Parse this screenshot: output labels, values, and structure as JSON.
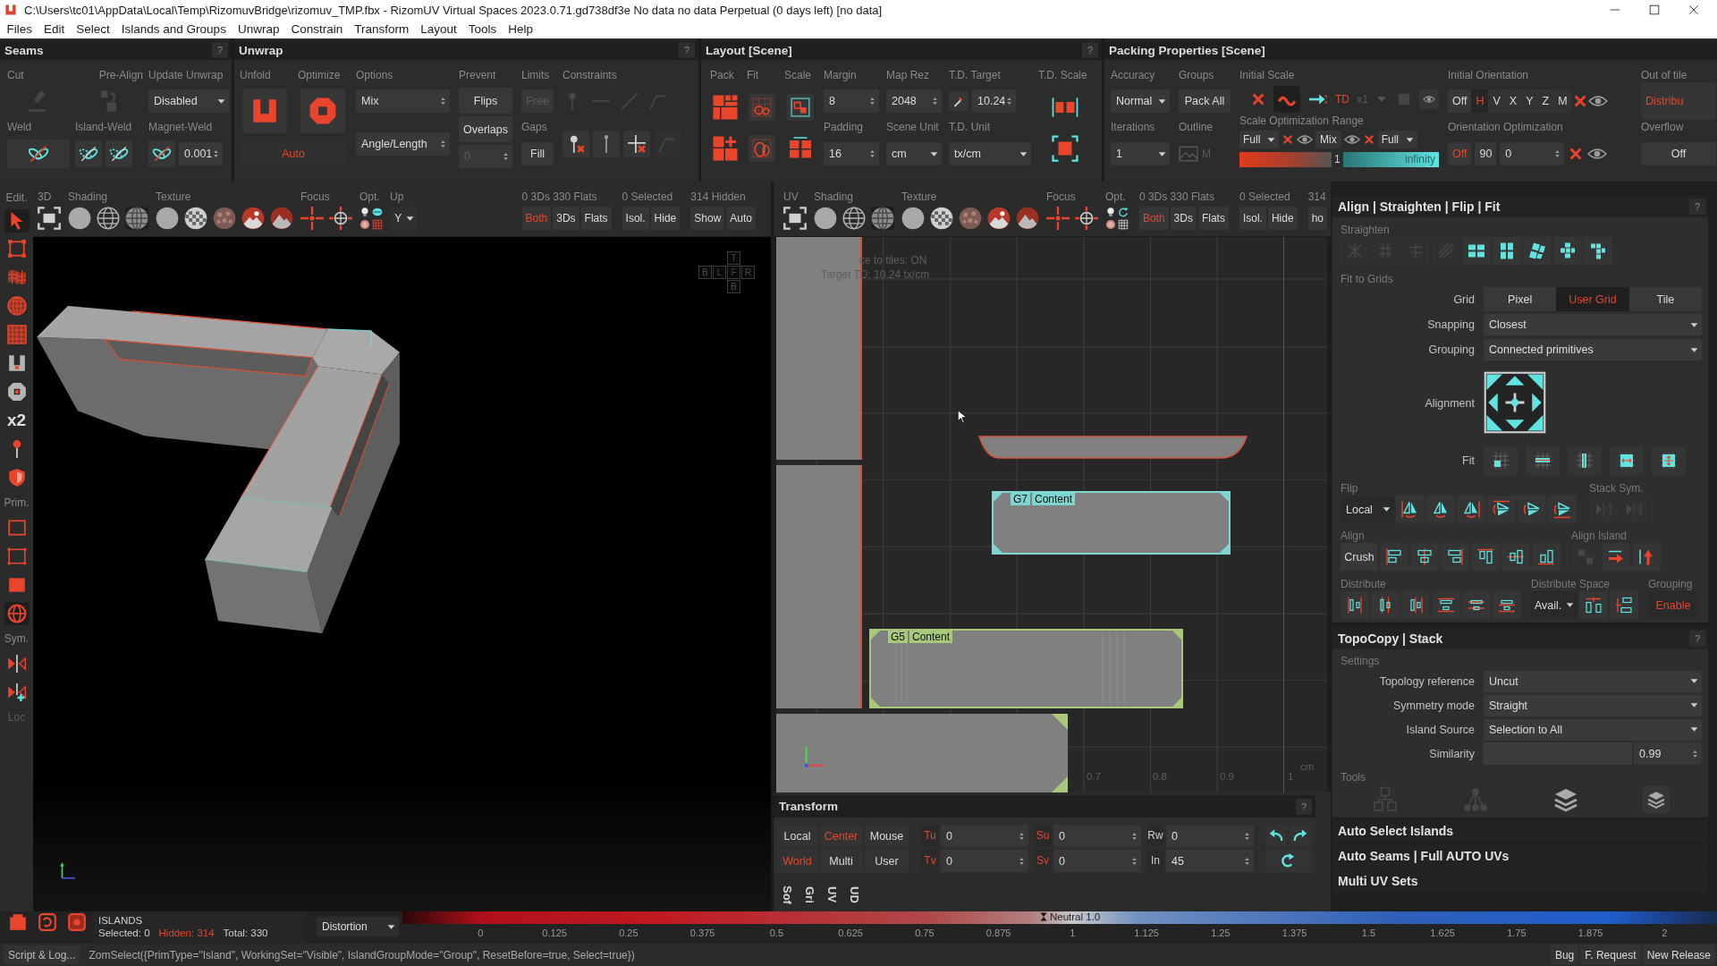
{
  "window": {
    "title": "C:\\Users\\tc01\\AppData\\Local\\Temp\\RizomuvBridge\\rizomuv_TMP.fbx - RizomUV  Virtual Spaces 2023.0.71.gd738df3e No data no data Perpetual  (0 days left) [no data]"
  },
  "menu": [
    "Files",
    "Edit",
    "Select",
    "Islands and Groups",
    "Unwrap",
    "Constrain",
    "Transform",
    "Layout",
    "Tools",
    "Help"
  ],
  "seams": {
    "title": "Seams",
    "help": "?",
    "cut": {
      "label": "Cut",
      "disabled": true
    },
    "pre_align": {
      "label": "Pre-Align",
      "disabled": true
    },
    "update_unwrap": {
      "label": "Update Unwrap",
      "value": "Disabled"
    },
    "weld": {
      "label": "Weld"
    },
    "island_weld": {
      "label": "Island-Weld"
    },
    "magnet_weld": {
      "label": "Magnet-Weld",
      "value": "0.001"
    }
  },
  "unwrap": {
    "title": "Unwrap",
    "help": "?",
    "unfold": "Unfold",
    "optimize": "Optimize",
    "auto": "Auto",
    "options": {
      "label": "Options",
      "values": [
        "Mix",
        "Angle/Length"
      ]
    },
    "prevent": {
      "label": "Prevent",
      "buttons": [
        "Flips",
        "Overlaps"
      ],
      "field": {
        "value": "0",
        "disabled": true
      }
    },
    "limits": {
      "label": "Limits",
      "free": {
        "label": "Free",
        "disabled": true
      },
      "gaps": "Gaps",
      "fill": "Fill"
    },
    "constraints": {
      "label": "Constraints",
      "tools": [
        {
          "disabled": true
        },
        {
          "disabled": true
        },
        {
          "disabled": true
        },
        {
          "disabled": true
        },
        {
          "disabled": false
        },
        {
          "disabled": false
        },
        {
          "disabled": false
        },
        {
          "disabled": true
        }
      ]
    }
  },
  "layout": {
    "title": "Layout [Scene]",
    "help": "?",
    "pack": "Pack",
    "fit": "Fit",
    "scale": "Scale",
    "margin": {
      "label": "Margin",
      "value": "8"
    },
    "padding": {
      "label": "Padding",
      "value": "16"
    },
    "map_rez": {
      "label": "Map Rez",
      "value": "2048"
    },
    "scene_unit": {
      "label": "Scene Unit",
      "value": "cm"
    },
    "td_target": {
      "label": "T.D. Target",
      "value": "10.24"
    },
    "td_unit": {
      "label": "T.D. Unit",
      "value": "tx/cm"
    },
    "td_scale": "T.D. Scale"
  },
  "packing": {
    "title": "Packing Properties [Scene]",
    "accuracy": {
      "label": "Accuracy",
      "value": "Normal"
    },
    "iterations": {
      "label": "Iterations",
      "value": "1"
    },
    "groups": {
      "label": "Groups",
      "value": "Pack All"
    },
    "outline": {
      "label": "Outline",
      "value": "M"
    },
    "initial_scale": {
      "label": "Initial Scale",
      "td": "TD",
      "factor": "x1"
    },
    "scale_range": {
      "label": "Scale Optimization Range",
      "min": "Full",
      "mode": "Mix",
      "max": "Full",
      "mid": "1",
      "end": "infinity"
    },
    "initial_orientation": {
      "label": "Initial Orientation",
      "off": "Off",
      "axes": [
        {
          "label": "H",
          "selected": true
        },
        {
          "label": "V",
          "selected": false
        },
        {
          "label": "X",
          "selected": false
        },
        {
          "label": "Y",
          "selected": false
        },
        {
          "label": "Z",
          "selected": false
        },
        {
          "label": "M",
          "selected": false
        }
      ]
    },
    "orientation_optimization": {
      "label": "Orientation Optimization",
      "toggle": {
        "label": "Off",
        "active": true
      },
      "step": "90",
      "value": "0"
    },
    "out_of_tiles": {
      "label": "Out of tile",
      "value": "Distribu"
    },
    "overflow": {
      "label": "Overflow",
      "value": "Off"
    }
  },
  "viewport_3d": {
    "groups": {
      "edit": "Edit.",
      "view": "3D",
      "shading": "Shading",
      "texture": "Texture",
      "focus": "Focus",
      "options": "Opt.",
      "up": "Up"
    },
    "shading": [
      {
        "selected": false
      },
      {
        "selected": false
      },
      {
        "selected": true
      }
    ],
    "up_axis": "Y",
    "stats": [
      "0 3Ds 330 Flats",
      "0 Selected",
      "314 Hidden"
    ],
    "filters": [
      {
        "label": "Both",
        "selected": true
      },
      {
        "label": "3Ds",
        "selected": false
      },
      {
        "label": "Flats",
        "selected": false
      }
    ],
    "actions": [
      "Isol.",
      "Hide",
      "Show",
      "Auto"
    ],
    "view_cube": [
      "T",
      "B",
      "L",
      "F",
      "R",
      "B"
    ]
  },
  "tool_column": {
    "items": [
      {
        "kind": "tool",
        "selected": true
      },
      {
        "kind": "tool",
        "selected": false
      },
      {
        "kind": "tool",
        "selected": false
      },
      {
        "kind": "tool",
        "selected": false
      },
      {
        "kind": "tool",
        "selected": false
      },
      {
        "kind": "tool",
        "selected": false
      },
      {
        "kind": "tool",
        "selected": false
      },
      {
        "kind": "badge",
        "text": "x2"
      },
      {
        "kind": "tool",
        "selected": false
      },
      {
        "kind": "tool",
        "selected": false
      },
      {
        "kind": "label",
        "text": "Prim.",
        "disabled": false
      },
      {
        "kind": "tool",
        "selected": false
      },
      {
        "kind": "tool",
        "selected": false
      },
      {
        "kind": "tool",
        "selected": false
      },
      {
        "kind": "tool",
        "selected": true
      },
      {
        "kind": "label",
        "text": "Sym.",
        "disabled": false
      },
      {
        "kind": "tool",
        "selected": false
      },
      {
        "kind": "tool",
        "selected": false
      },
      {
        "kind": "label",
        "text": "Loc",
        "disabled": true
      }
    ]
  },
  "viewport_uv": {
    "groups": {
      "view": "UV",
      "shading": "Shading",
      "texture": "Texture",
      "focus": "Focus",
      "options": "Opt."
    },
    "shading": [
      {
        "selected": false
      },
      {
        "selected": false
      },
      {
        "selected": true
      }
    ],
    "stats": [
      "0 3Ds 330 Flats",
      "0 Selected",
      "314"
    ],
    "filters": [
      {
        "label": "Both",
        "selected": true
      },
      {
        "label": "3Ds",
        "selected": false
      },
      {
        "label": "Flats",
        "selected": false
      }
    ],
    "actions": [
      "Isol.",
      "Hide",
      "ho"
    ],
    "overlay": [
      "ce to tiles: ON",
      "Target TD: 10.24 tx/cm"
    ],
    "ruler": [
      "0.7",
      "0.8",
      "0.9",
      "1"
    ],
    "unit": "cm",
    "islands": [
      {
        "kind": "strip"
      },
      {
        "kind": "strip"
      },
      {
        "kind": "curved"
      },
      {
        "kind": "group",
        "group": "G7",
        "label": "Content",
        "color": "#7dd6d0"
      },
      {
        "kind": "group",
        "group": "G5",
        "label": "Content",
        "color": "#a8c97c"
      },
      {
        "kind": "corner",
        "color": "#a8c97c"
      }
    ]
  },
  "transform": {
    "title": "Transform",
    "help": "?",
    "pivots": [
      {
        "label": "Local",
        "selected": false
      },
      {
        "label": "Center",
        "selected": true
      },
      {
        "label": "Mouse",
        "selected": false
      },
      {
        "label": "World",
        "selected": true
      },
      {
        "label": "Multi",
        "selected": false
      },
      {
        "label": "User",
        "selected": false
      }
    ],
    "fields": [
      {
        "label": "Tu",
        "value": "0",
        "active": true
      },
      {
        "label": "Su",
        "value": "0",
        "active": true
      },
      {
        "label": "Rw",
        "value": "0",
        "active": false
      },
      {
        "label": "Tv",
        "value": "0",
        "active": true
      },
      {
        "label": "Sv",
        "value": "0",
        "active": true
      },
      {
        "label": "In",
        "value": "45",
        "active": false
      }
    ],
    "tabs": [
      "Sof",
      "Gri",
      "UV",
      "UD"
    ]
  },
  "align_panel": {
    "title": "Align | Straighten | Flip | Fit",
    "help": "?",
    "straighten": {
      "label": "Straighten",
      "tools": [
        {
          "disabled": true
        },
        {
          "disabled": true
        },
        {
          "disabled": true
        },
        {
          "disabled": true
        },
        {
          "disabled": false
        },
        {
          "disabled": false
        },
        {
          "disabled": false
        },
        {
          "disabled": false
        },
        {
          "disabled": false
        }
      ]
    },
    "fit_to_grids": "Fit to Grids",
    "grid": {
      "label": "Grid",
      "options": [
        {
          "label": "Pixel",
          "selected": false
        },
        {
          "label": "User Grid",
          "selected": true
        },
        {
          "label": "Tile",
          "selected": false
        }
      ]
    },
    "snapping": {
      "label": "Snapping",
      "value": "Closest"
    },
    "grouping": {
      "label": "Grouping",
      "value": "Connected primitives"
    },
    "alignment": "Alignment",
    "fit": "Fit",
    "flip": {
      "label": "Flip",
      "space": "Local"
    },
    "stack_sym": {
      "label": "Stack Sym.",
      "tools": [
        {
          "disabled": true
        },
        {
          "disabled": true
        }
      ]
    },
    "align": {
      "label": "Align",
      "crush": "Crush"
    },
    "align_island": {
      "label": "Align Island",
      "tools": [
        {
          "disabled": true
        },
        {
          "disabled": false
        },
        {
          "disabled": false
        }
      ]
    },
    "distribute": "Distribute",
    "distribute_space": {
      "label": "Distribute Space",
      "value": "Avail."
    },
    "distribute_grouping": {
      "label": "Grouping",
      "value": "Enable"
    }
  },
  "topocopy": {
    "title": "TopoCopy | Stack",
    "help": "?",
    "settings": "Settings",
    "rows": [
      {
        "kind": "dropdown",
        "label": "Topology reference",
        "value": "Uncut"
      },
      {
        "kind": "dropdown",
        "label": "Symmetry mode",
        "value": "Straight"
      },
      {
        "kind": "dropdown",
        "label": "Island Source",
        "value": "Selection to All"
      },
      {
        "kind": "slider",
        "label": "Similarity",
        "value": "0.99"
      }
    ],
    "tools": {
      "label": "Tools",
      "items": [
        {
          "disabled": true
        },
        {
          "disabled": true
        },
        {
          "disabled": false
        },
        {
          "disabled": false
        }
      ]
    }
  },
  "sections": [
    "Auto Select Islands",
    "Auto Seams | Full AUTO UVs",
    "Multi UV Sets"
  ],
  "status": {
    "mode": "ISLANDS",
    "selected": "Selected: 0",
    "hidden": "Hidden: 314",
    "total": "Total: 330",
    "map": "Distortion",
    "neutral": "Neutral 1.0",
    "scale": [
      "0",
      "0.125",
      "0.25",
      "0.375",
      "0.5",
      "0.625",
      "0.75",
      "0.875",
      "1",
      "1.125",
      "1.25",
      "1.375",
      "1.5",
      "1.625",
      "1.75",
      "1.875",
      "2"
    ],
    "log": "Script & Log...",
    "command": "ZomSelect({PrimType=\"Island\", WorkingSet=\"Visible\", IslandGroupMode=\"Group\", ResetBefore=true, Select=true})",
    "links": [
      "Bug",
      "F. Request",
      "New Release"
    ]
  }
}
